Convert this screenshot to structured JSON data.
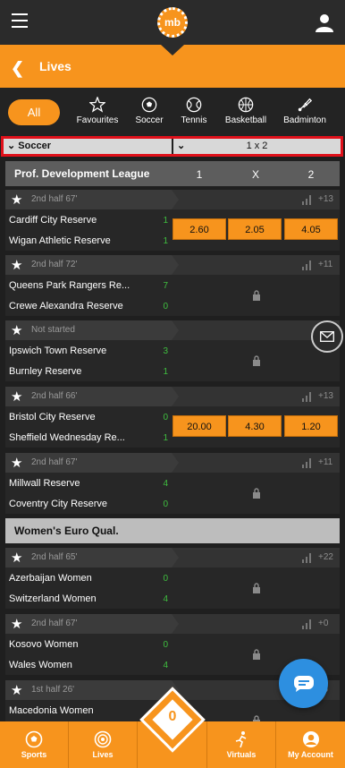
{
  "header": {
    "logo_text": "mb"
  },
  "lives_bar": {
    "title": "Lives"
  },
  "sport_tabs": {
    "all_label": "All",
    "items": [
      {
        "label": "Favourites",
        "icon": "star-icon"
      },
      {
        "label": "Soccer",
        "icon": "soccer-ball-icon"
      },
      {
        "label": "Tennis",
        "icon": "tennis-ball-icon"
      },
      {
        "label": "Basketball",
        "icon": "basketball-icon"
      },
      {
        "label": "Badminton",
        "icon": "shuttlecock-icon"
      }
    ]
  },
  "selector": {
    "sport": "Soccer",
    "market": "1 x 2"
  },
  "league_columns": [
    "1",
    "X",
    "2"
  ],
  "leagues": [
    {
      "name": "Prof. Development League",
      "matches": [
        {
          "status": "2nd half 67'",
          "more": "+13",
          "home": "Cardiff City Reserve",
          "away": "Wigan Athletic Reserve",
          "home_score": "1",
          "away_score": "1",
          "odds": [
            "2.60",
            "2.05",
            "4.05"
          ]
        },
        {
          "status": "2nd half 72'",
          "more": "+11",
          "home": "Queens Park Rangers Re...",
          "away": "Crewe Alexandra Reserve",
          "home_score": "7",
          "away_score": "0",
          "odds": []
        },
        {
          "status": "Not started",
          "more": "",
          "home": "Ipswich Town Reserve",
          "away": "Burnley Reserve",
          "home_score": "3",
          "away_score": "1",
          "odds": []
        },
        {
          "status": "2nd half 66'",
          "more": "+13",
          "home": "Bristol City Reserve",
          "away": "Sheffield Wednesday Re...",
          "home_score": "0",
          "away_score": "1",
          "odds": [
            "20.00",
            "4.30",
            "1.20"
          ]
        },
        {
          "status": "2nd half 67'",
          "more": "+11",
          "home": "Millwall Reserve",
          "away": "Coventry City Reserve",
          "home_score": "4",
          "away_score": "0",
          "odds": []
        }
      ]
    },
    {
      "name": "Women's Euro Qual.",
      "matches": [
        {
          "status": "2nd half 65'",
          "more": "+22",
          "home": "Azerbaijan Women",
          "away": "Switzerland Women",
          "home_score": "0",
          "away_score": "4",
          "odds": []
        },
        {
          "status": "2nd half 67'",
          "more": "+0",
          "home": "Kosovo Women",
          "away": "Wales Women",
          "home_score": "0",
          "away_score": "4",
          "odds": []
        },
        {
          "status": "1st half 26'",
          "more": "55",
          "home": "Macedonia Women",
          "away": "",
          "home_score": "",
          "away_score": "",
          "odds": []
        }
      ]
    }
  ],
  "bottom_nav": {
    "items": [
      {
        "label": "Sports",
        "icon": "soccer-ball-icon"
      },
      {
        "label": "Lives",
        "icon": "live-target-icon"
      },
      {
        "label": "Virtuals",
        "icon": "runner-icon"
      },
      {
        "label": "My Account",
        "icon": "account-icon"
      }
    ],
    "betslip_count": "0"
  },
  "colors": {
    "accent": "#f7941d",
    "background": "#1f1f1f",
    "highlight_border": "#e0101a",
    "chat": "#2d8fe0",
    "score": "#3fbf3f"
  }
}
